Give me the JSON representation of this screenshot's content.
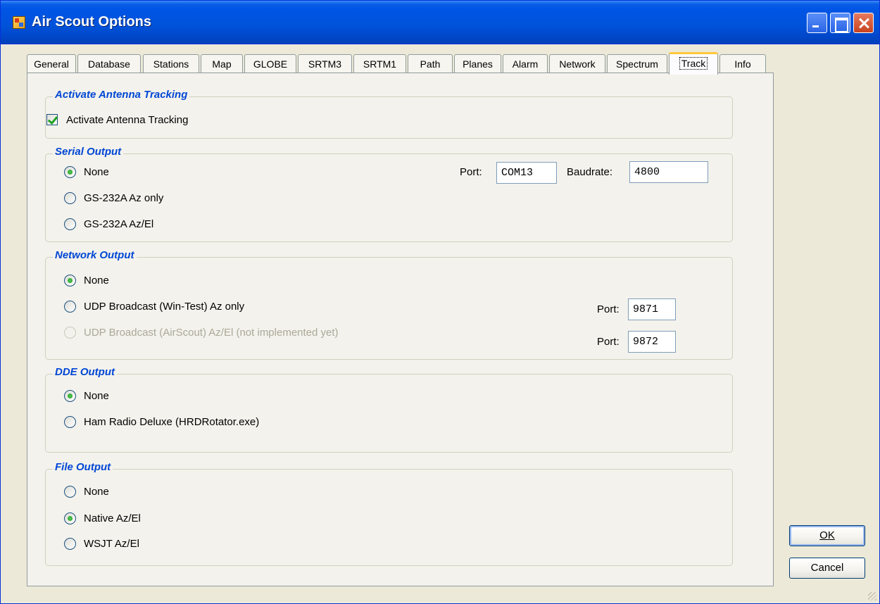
{
  "window": {
    "title": "Air Scout Options"
  },
  "tabs": [
    {
      "label": "General"
    },
    {
      "label": "Database"
    },
    {
      "label": "Stations"
    },
    {
      "label": "Map"
    },
    {
      "label": "GLOBE"
    },
    {
      "label": "SRTM3"
    },
    {
      "label": "SRTM1"
    },
    {
      "label": "Path"
    },
    {
      "label": "Planes"
    },
    {
      "label": "Alarm"
    },
    {
      "label": "Network"
    },
    {
      "label": "Spectrum"
    },
    {
      "label": "Track"
    },
    {
      "label": "Info"
    }
  ],
  "active_tab": "Track",
  "activate": {
    "title": "Activate Antenna Tracking",
    "checkbox_label": "Activate Antenna Tracking",
    "checked": true
  },
  "serial": {
    "title": "Serial Output",
    "options": [
      "None",
      "GS-232A Az only",
      "GS-232A Az/El"
    ],
    "selected": "None",
    "port_label": "Port:",
    "port_value": "COM13",
    "baud_label": "Baudrate:",
    "baud_value": "4800"
  },
  "network": {
    "title": "Network Output",
    "options": [
      "None",
      "UDP Broadcast (Win-Test) Az only",
      "UDP Broadcast (AirScout) Az/El (not implemented yet)"
    ],
    "selected": "None",
    "port1_label": "Port:",
    "port1_value": "9871",
    "port2_label": "Port:",
    "port2_value": "9872"
  },
  "dde": {
    "title": "DDE Output",
    "options": [
      "None",
      "Ham Radio Deluxe (HRDRotator.exe)"
    ],
    "selected": "None"
  },
  "file": {
    "title": "File Output",
    "options": [
      "None",
      "Native Az/El",
      "WSJT Az/El"
    ],
    "selected": "Native Az/El"
  },
  "buttons": {
    "ok": "OK",
    "cancel": "Cancel"
  },
  "colors": {
    "group_title": "#0046d5",
    "titlebar": "#0055e5",
    "active_tab_accent": "#ffc83c"
  }
}
